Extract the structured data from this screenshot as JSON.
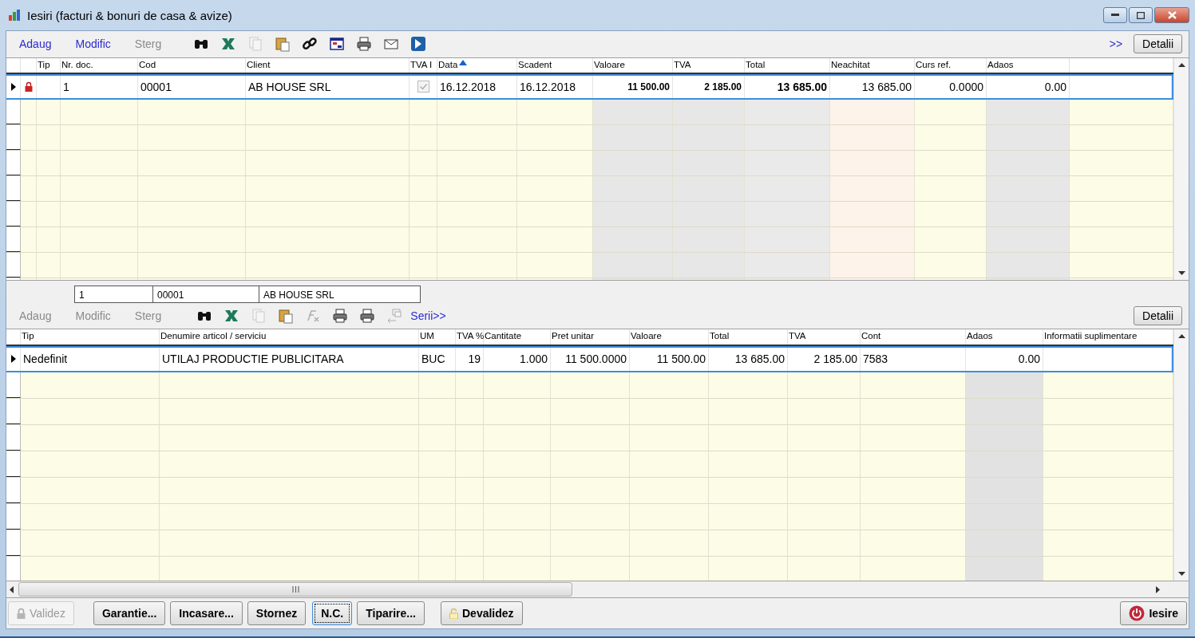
{
  "window": {
    "title": "Iesiri (facturi & bonuri de casa & avize)"
  },
  "documents": {
    "toolbar": {
      "actions": [
        {
          "label": "Adaug",
          "disabled": false
        },
        {
          "label": "Modific",
          "disabled": false
        },
        {
          "label": "Sterg",
          "disabled": true
        }
      ],
      "more_link": ">>",
      "details_button": "Detalii"
    },
    "columns": [
      {
        "label": "Tip",
        "sorted": false
      },
      {
        "label": "Nr. doc.",
        "sorted": false
      },
      {
        "label": "Cod",
        "sorted": false
      },
      {
        "label": "Client",
        "sorted": false
      },
      {
        "label": "TVA I",
        "sorted": false
      },
      {
        "label": "Data",
        "sorted": true
      },
      {
        "label": "Scadent",
        "sorted": false
      },
      {
        "label": "Valoare",
        "sorted": false
      },
      {
        "label": "TVA",
        "sorted": false
      },
      {
        "label": "Total",
        "sorted": false
      },
      {
        "label": "Neachitat",
        "sorted": false
      },
      {
        "label": "Curs ref.",
        "sorted": false
      },
      {
        "label": "Adaos",
        "sorted": false
      }
    ],
    "rows": [
      {
        "selected": true,
        "locked": true,
        "cells": [
          null,
          "1",
          "00001",
          "AB HOUSE SRL",
          {
            "kind": "checkbox",
            "checked": true,
            "disabled": true
          },
          "16.12.2018",
          "16.12.2018",
          "11 500.00",
          "2 185.00",
          "13 685.00",
          "13 685.00",
          "0.0000",
          "0.00"
        ]
      }
    ]
  },
  "summary": [
    "1",
    "00001",
    "AB HOUSE SRL"
  ],
  "lines": {
    "toolbar": {
      "actions": [
        {
          "label": "Adaug",
          "disabled": true
        },
        {
          "label": "Modific",
          "disabled": true
        },
        {
          "label": "Sterg",
          "disabled": true
        }
      ],
      "series_link": "Serii>>",
      "details_button": "Detalii"
    },
    "columns": [
      {
        "label": "Tip"
      },
      {
        "label": "Denumire articol / serviciu"
      },
      {
        "label": "UM"
      },
      {
        "label": "TVA %"
      },
      {
        "label": "Cantitate"
      },
      {
        "label": "Pret unitar"
      },
      {
        "label": "Valoare"
      },
      {
        "label": "Total"
      },
      {
        "label": "TVA"
      },
      {
        "label": "Cont"
      },
      {
        "label": "Adaos"
      },
      {
        "label": "Informatii suplimentare"
      }
    ],
    "rows": [
      {
        "selected": true,
        "cells": [
          "Nedefinit",
          "UTILAJ PRODUCTIE PUBLICITARA",
          "BUC",
          "19",
          "1.000",
          "11 500.0000",
          "11 500.00",
          "13 685.00",
          "2 185.00",
          "7583",
          "0.00",
          null
        ]
      }
    ]
  },
  "buttons": [
    {
      "label": "Validez",
      "kind": "lock",
      "disabled": true,
      "focused": false
    },
    {
      "label": "Garantie...",
      "kind": "plain",
      "disabled": false,
      "focused": false
    },
    {
      "label": "Incasare...",
      "kind": "plain",
      "disabled": false,
      "focused": false
    },
    {
      "label": "Stornez",
      "kind": "plain",
      "disabled": false,
      "focused": false
    },
    {
      "label": "N.C.",
      "kind": "plain",
      "disabled": false,
      "focused": true
    },
    {
      "label": "Tiparire...",
      "kind": "plain",
      "disabled": false,
      "focused": false
    },
    {
      "label": "Devalidez",
      "kind": "unlock",
      "disabled": false,
      "focused": false
    },
    {
      "label": "Iesire",
      "kind": "power",
      "disabled": false,
      "focused": false
    }
  ]
}
